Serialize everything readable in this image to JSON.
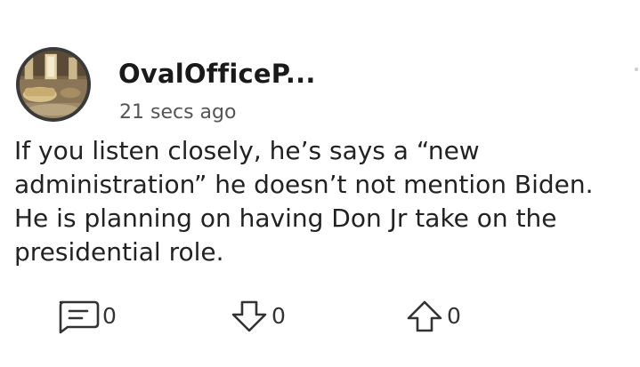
{
  "post": {
    "username": "OvalOfficeP...",
    "timestamp": "21 secs ago",
    "body": "If you listen closely, he’s says a “new administration” he doesn’t not mention Biden. He is planning on having Don Jr take on the presidential role.",
    "avatar_icon": "avatar-oval-office-photo"
  },
  "actions": {
    "comments": {
      "icon": "comment-icon",
      "count": "0"
    },
    "downvote": {
      "icon": "downvote-arrow-icon",
      "count": "0"
    },
    "upvote": {
      "icon": "upvote-arrow-icon",
      "count": "0"
    }
  },
  "colors": {
    "text": "#222222",
    "muted": "#555555",
    "icon_stroke": "#333333",
    "background": "#ffffff"
  }
}
